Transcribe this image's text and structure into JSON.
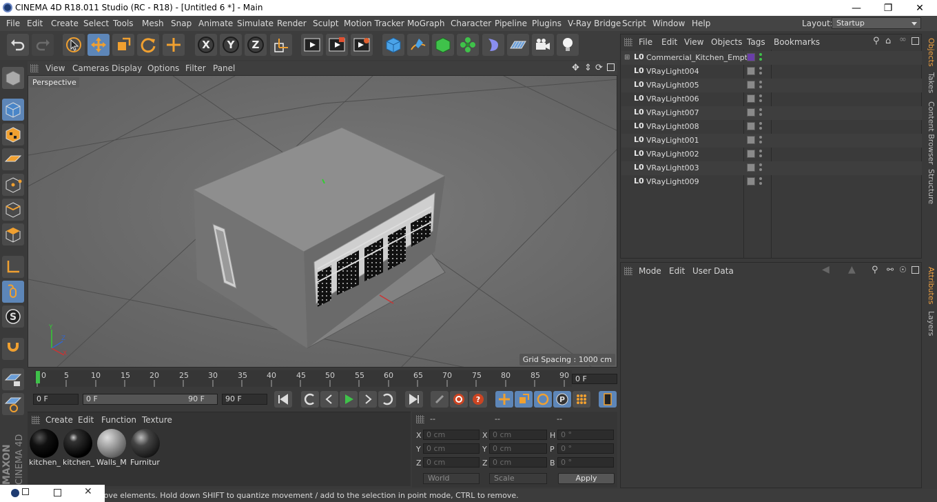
{
  "window": {
    "title": "CINEMA 4D R18.011 Studio (RC - R18) - [Untitled 6 *] - Main",
    "min_icon": "minimize-icon",
    "max_icon": "maximize-icon",
    "close_icon": "close-icon"
  },
  "menu": [
    "File",
    "Edit",
    "Create",
    "Select",
    "Tools",
    "Mesh",
    "Snap",
    "Animate",
    "Simulate",
    "Render",
    "Sculpt",
    "Motion Tracker",
    "MoGraph",
    "Character",
    "Pipeline",
    "Plugins",
    "V-Ray Bridge",
    "Script",
    "Window",
    "Help"
  ],
  "layout": {
    "label": "Layout:",
    "value": "Startup"
  },
  "toolbar_icons": [
    "undo-icon",
    "redo-icon",
    "live-selection-icon",
    "move-icon",
    "scale-icon",
    "rotate-icon",
    "last-tool-icon",
    "x-axis-icon",
    "y-axis-icon",
    "z-axis-icon",
    "coordinate-system-icon",
    "render-view-icon",
    "render-picture-viewer-icon",
    "edit-render-settings-icon",
    "cube-icon",
    "pen-icon",
    "subdivision-icon",
    "cloner-icon",
    "deformer-icon",
    "floor-icon",
    "camera-icon",
    "light-icon"
  ],
  "viewport": {
    "menu": [
      "View",
      "Cameras",
      "Display",
      "Options",
      "Filter",
      "Panel"
    ],
    "label": "Perspective",
    "grid_spacing": "Grid Spacing : 1000 cm"
  },
  "timeline": {
    "ticks": [
      "0",
      "5",
      "10",
      "15",
      "20",
      "25",
      "30",
      "35",
      "40",
      "45",
      "50",
      "55",
      "60",
      "65",
      "70",
      "75",
      "80",
      "85",
      "90"
    ],
    "frame": "0 F"
  },
  "playback": {
    "start": "0 F",
    "range_start": "0 F",
    "range_end": "90 F",
    "end": "90 F"
  },
  "materials": {
    "menu": [
      "Create",
      "Edit",
      "Function",
      "Texture"
    ],
    "items": [
      {
        "name": "kitchen_",
        "color": "#0a0a0a"
      },
      {
        "name": "kitchen_",
        "color": "#1a1a1a"
      },
      {
        "name": "Walls_M",
        "color": "#9a9a9a"
      },
      {
        "name": "Furnitur",
        "color": "#2a2a2a"
      }
    ]
  },
  "coords": {
    "headers": [
      "--",
      "--",
      "--"
    ],
    "rows": [
      {
        "a": "X",
        "av": "0 cm",
        "b": "X",
        "bv": "0 cm",
        "c": "H",
        "cv": "0 °"
      },
      {
        "a": "Y",
        "av": "0 cm",
        "b": "Y",
        "bv": "0 cm",
        "c": "P",
        "cv": "0 °"
      },
      {
        "a": "Z",
        "av": "0 cm",
        "b": "Z",
        "bv": "0 cm",
        "c": "B",
        "cv": "0 °"
      }
    ],
    "world": "World",
    "scale": "Scale",
    "apply": "Apply"
  },
  "objects": {
    "menu": [
      "File",
      "Edit",
      "View",
      "Objects",
      "Tags",
      "Bookmarks"
    ],
    "items": [
      {
        "lo": "L0",
        "name": "Commercial_Kitchen_Empty"
      },
      {
        "lo": "L0",
        "name": "VRayLight004"
      },
      {
        "lo": "L0",
        "name": "VRayLight005"
      },
      {
        "lo": "L0",
        "name": "VRayLight006"
      },
      {
        "lo": "L0",
        "name": "VRayLight007"
      },
      {
        "lo": "L0",
        "name": "VRayLight008"
      },
      {
        "lo": "L0",
        "name": "VRayLight001"
      },
      {
        "lo": "L0",
        "name": "VRayLight002"
      },
      {
        "lo": "L0",
        "name": "VRayLight003"
      },
      {
        "lo": "L0",
        "name": "VRayLight009"
      }
    ]
  },
  "attributes": {
    "menu": [
      "Mode",
      "Edit",
      "User Data"
    ]
  },
  "right_tabs": [
    "Objects",
    "Takes",
    "Content Browser",
    "Structure",
    "Attributes",
    "Layers"
  ],
  "brand": {
    "maxon": "MAXON",
    "c4d": "CINEMA 4D"
  },
  "status": "move elements. Hold down SHIFT to quantize movement / add to the selection in point mode, CTRL to remove.",
  "colors": {
    "accent": "#5d86b8",
    "tab_active": "#f0a040",
    "play": "#3fc24a"
  }
}
